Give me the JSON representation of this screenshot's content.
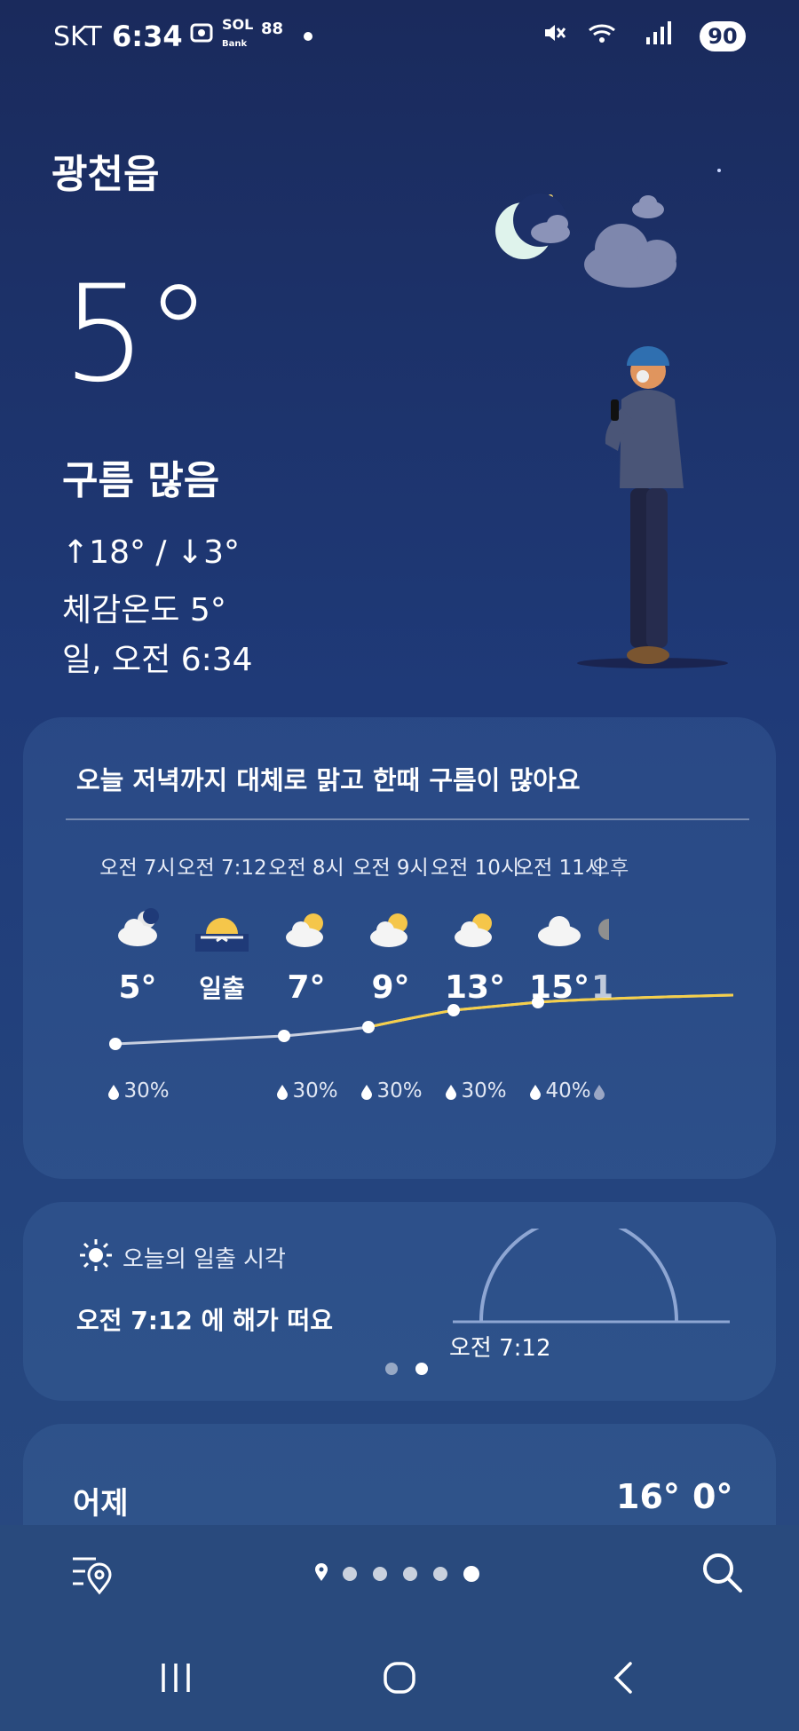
{
  "status_bar": {
    "carrier": "SKT",
    "time": "6:34",
    "battery": "90",
    "icons": [
      "screenshot-icon",
      "sol-bank-icon",
      "app-icon",
      "dot-icon",
      "mute-icon",
      "wifi-icon",
      "signal-icon"
    ]
  },
  "location": "광천읍",
  "current": {
    "temp": "5°",
    "condition": "구름 많음",
    "hilo": "↑18° / ↓3°",
    "feels_like": "체감온도 5°",
    "datetime": "일, 오전 6:34"
  },
  "hourly": {
    "summary": "오늘 저녁까지 대체로 맑고 한때 구름이 많아요",
    "items": [
      {
        "time": "오전 7시",
        "icon": "moon-cloud-icon",
        "temp": "5°",
        "precip": "30%"
      },
      {
        "time": "오전 7:12",
        "icon": "sunrise-icon",
        "temp": "일출",
        "precip": ""
      },
      {
        "time": "오전 8시",
        "icon": "sun-cloud-icon",
        "temp": "7°",
        "precip": "30%"
      },
      {
        "time": "오전 9시",
        "icon": "sun-cloud-icon",
        "temp": "9°",
        "precip": "30%"
      },
      {
        "time": "오전 10시",
        "icon": "sun-cloud-icon",
        "temp": "13°",
        "precip": "30%"
      },
      {
        "time": "오전 11시",
        "icon": "cloud-icon",
        "temp": "15°",
        "precip": "40%"
      },
      {
        "time": "오후",
        "icon": "partial-icon",
        "temp": "1",
        "precip": ""
      }
    ]
  },
  "sunrise": {
    "title": "오늘의 일출 시각",
    "message": "오전 7:12 에 해가 떠요",
    "time_label": "오전 7:12"
  },
  "yesterday": {
    "label": "어제",
    "high": "16°",
    "low": "0°"
  },
  "colors": {
    "background_top": "#1a2a5c",
    "background_bottom": "#2a4a80",
    "graph_yellow": "#f5cf4a"
  }
}
